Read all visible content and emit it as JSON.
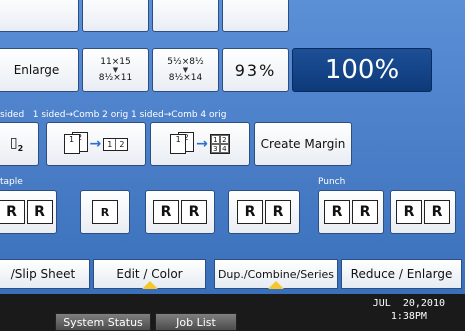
{
  "zoom": {
    "enlarge": "Enlarge",
    "size1_top": "11×15",
    "size1_bot": "8½×11",
    "size2_top": "5½×8½",
    "size2_bot": "8½×14",
    "pct93": "93%",
    "pct100": "100%"
  },
  "combine": {
    "label_row": "sided   1 sided→Comb 2 orig 1 sided→Comb 4 orig",
    "create_margin": "Create Margin"
  },
  "labels": {
    "staple": "taple",
    "punch": "Punch"
  },
  "tabs": {
    "slip_sheet": "/Slip Sheet",
    "edit_color": "Edit / Color",
    "dup": "Dup./Combine/Series",
    "reduce": "Reduce / Enlarge"
  },
  "status": {
    "system_status": "System Status",
    "job_list": "Job List",
    "date": "JUL  20,2010",
    "time": "1:38PM"
  },
  "colors": {
    "accent_dark": "#0d3a7a",
    "tab_indicator": "#f7c62b",
    "panel": "#3f78c3"
  }
}
